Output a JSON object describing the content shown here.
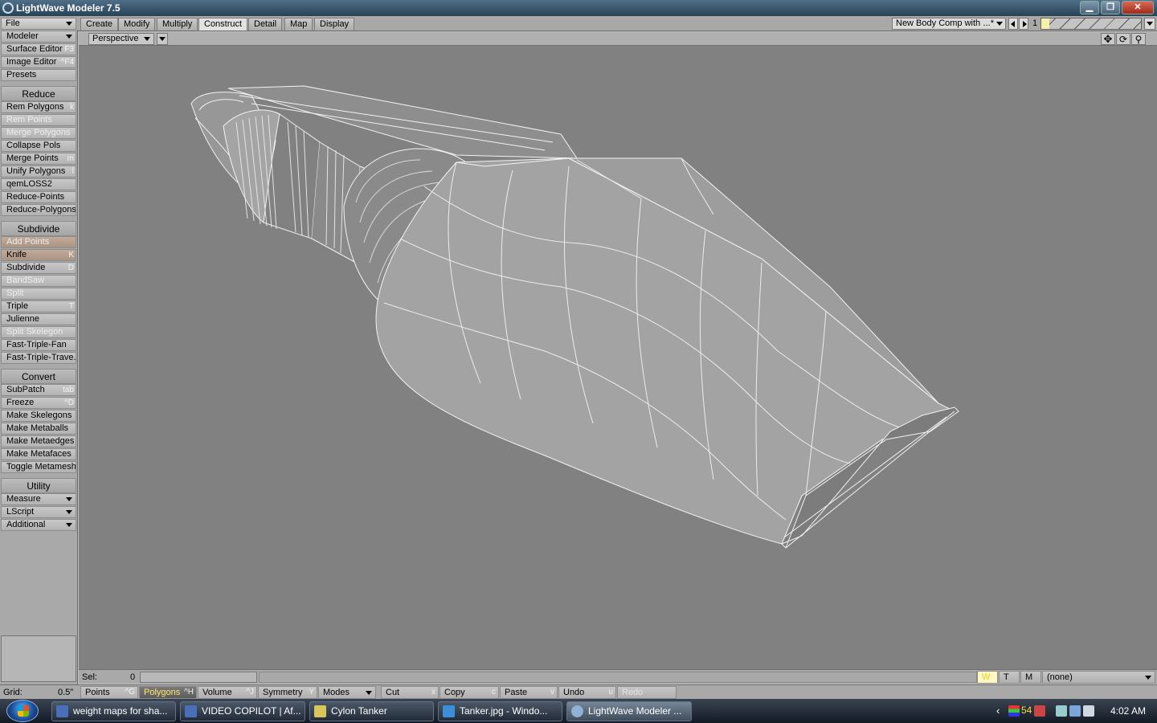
{
  "window": {
    "title": "LightWave Modeler 7.5",
    "controls": [
      "minimize-icon",
      "restore-icon",
      "close-icon"
    ]
  },
  "tabs": {
    "file_menu": "File",
    "items": [
      {
        "label": "Create"
      },
      {
        "label": "Modify"
      },
      {
        "label": "Multiply"
      },
      {
        "label": "Construct",
        "active": true
      },
      {
        "label": "Detail"
      },
      {
        "label": "Map"
      },
      {
        "label": "Display"
      }
    ],
    "body_comp": "New Body Comp with",
    "body_comp_suffix": "...*",
    "layer_number": "1"
  },
  "viewport": {
    "view_mode": "Perspective"
  },
  "sidebar": {
    "top": [
      {
        "label": "Modeler",
        "dropdown": true
      },
      {
        "label": "Surface Editor",
        "shortcut": "F3"
      },
      {
        "label": "Image Editor",
        "shortcut": "^F4"
      },
      {
        "label": "Presets"
      }
    ],
    "sections": {
      "reduce": {
        "title": "Reduce",
        "items": [
          {
            "label": "Rem Polygons",
            "shortcut": "k"
          },
          {
            "label": "Rem Points",
            "disabled": true
          },
          {
            "label": "Merge Polygons",
            "disabled": true
          },
          {
            "label": "Collapse Pols"
          },
          {
            "label": "Merge Points",
            "shortcut": "m"
          },
          {
            "label": "Unify Polygons",
            "shortcut": "l"
          },
          {
            "label": "qemLOSS2"
          },
          {
            "label": "Reduce-Points"
          },
          {
            "label": "Reduce-Polygons"
          }
        ]
      },
      "subdivide": {
        "title": "Subdivide",
        "items": [
          {
            "label": "Add Points",
            "disabled": true,
            "highlight": true
          },
          {
            "label": "Knife",
            "shortcut": "K",
            "highlight": true
          },
          {
            "label": "Subdivide",
            "shortcut": "D"
          },
          {
            "label": "BandSaw",
            "disabled": true
          },
          {
            "label": "Split",
            "disabled": true
          },
          {
            "label": "Triple",
            "shortcut": "T"
          },
          {
            "label": "Julienne"
          },
          {
            "label": "Split Skelegon",
            "disabled": true
          },
          {
            "label": "Fast-Triple-Fan"
          },
          {
            "label": "Fast-Triple-Trave..."
          }
        ]
      },
      "convert": {
        "title": "Convert",
        "items": [
          {
            "label": "SubPatch",
            "shortcut": "tab"
          },
          {
            "label": "Freeze",
            "shortcut": "^D"
          },
          {
            "label": "Make Skelegons"
          },
          {
            "label": "Make Metaballs"
          },
          {
            "label": "Make Metaedges"
          },
          {
            "label": "Make Metafaces"
          },
          {
            "label": "Toggle Metamesh"
          }
        ]
      },
      "utility": {
        "title": "Utility",
        "items": [
          {
            "label": "Measure",
            "dropdown": true
          },
          {
            "label": "LScript",
            "dropdown": true
          },
          {
            "label": "Additional",
            "dropdown": true
          }
        ]
      }
    }
  },
  "selbar": {
    "sel_label": "Sel:",
    "sel_value": "0",
    "w_label": "W",
    "t_label": "T",
    "m_label": "M",
    "vmap": "(none)"
  },
  "bottombar": {
    "grid_label": "Grid:",
    "grid_value": "0.5\"",
    "points": {
      "label": "Points",
      "shortcut": "^G"
    },
    "polygons": {
      "label": "Polygons",
      "shortcut": "^H"
    },
    "volume": {
      "label": "Volume",
      "shortcut": "^J"
    },
    "symmetry": {
      "label": "Symmetry",
      "shortcut": "Y"
    },
    "modes": {
      "label": "Modes"
    },
    "cut": {
      "label": "Cut",
      "shortcut": "x"
    },
    "copy": {
      "label": "Copy",
      "shortcut": "c"
    },
    "paste": {
      "label": "Paste",
      "shortcut": "v"
    },
    "undo": {
      "label": "Undo",
      "shortcut": "u"
    },
    "redo": {
      "label": "Redo"
    }
  },
  "taskbar": {
    "tasks": [
      {
        "label": "weight maps for sha...",
        "color": "#4a6fb8"
      },
      {
        "label": "VIDEO COPILOT | Af...",
        "color": "#4a6fb8"
      },
      {
        "label": "Cylon Tanker",
        "color": "#d9c65a"
      },
      {
        "label": "Tanker.jpg - Windo...",
        "color": "#3b8fd8"
      },
      {
        "label": "LightWave Modeler ...",
        "color": "#8fb2d8",
        "active": true
      }
    ],
    "tray_number": "54",
    "clock": "4:02 AM"
  }
}
